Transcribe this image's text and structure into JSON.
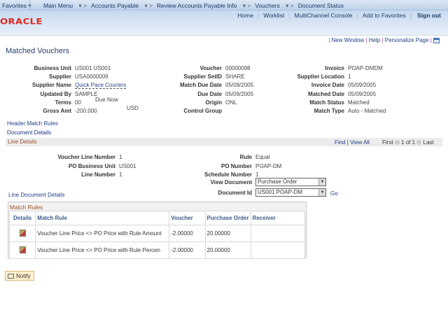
{
  "nav": {
    "favorites": "Favorites",
    "breadcrumb": [
      "Main Menu",
      "Accounts Payable",
      "Review Accounts Payable Info",
      "Vouchers",
      "Document Status"
    ],
    "links": [
      "Home",
      "Worklist",
      "MultiChannel Console",
      "Add to Favorites"
    ],
    "signout": "Sign out",
    "logo": "ORACLE"
  },
  "pagelinks": {
    "new_window": "New Window",
    "help": "Help",
    "personalize": "Personalize Page"
  },
  "title": "Matched Vouchers",
  "header": {
    "col1": [
      [
        "Business Unit",
        "US001   US001"
      ],
      [
        "Supplier",
        "USA0000009"
      ],
      [
        "Supplier Name",
        "Quick Pace Couriers"
      ],
      [
        "Updated By",
        "SAMPLE"
      ],
      [
        "Terms",
        "00"
      ],
      [
        "Gross Amt",
        "-200.000"
      ]
    ],
    "terms_desc": "Due Now",
    "currency": "USD",
    "col2": [
      [
        "Voucher",
        "00000098"
      ],
      [
        "Supplier SetID",
        "SHARE"
      ],
      [
        "Match Due Date",
        "05/09/2005"
      ],
      [
        "Due Date",
        "05/09/2005"
      ],
      [
        "Origin",
        "ONL"
      ],
      [
        "Control Group",
        ""
      ]
    ],
    "col3": [
      [
        "Invoice",
        "POAP-DMDM"
      ],
      [
        "Supplier Location",
        "1"
      ],
      [
        "Invoice Date",
        "05/09/2005"
      ],
      [
        "Matched Date",
        "05/09/2005"
      ],
      [
        "Match Status",
        "Matched"
      ],
      [
        "Match Type",
        "Auto - Matched"
      ]
    ]
  },
  "header_match_rules": "Header Match Rules",
  "document_details": "Document Details",
  "line_details": {
    "title": "Line Details",
    "find": "Find",
    "view_all": "View All",
    "first": "First",
    "count": "1 of 1",
    "last": "Last",
    "left": [
      [
        "Voucher Line Number",
        "1"
      ],
      [
        "PO Business Unit",
        "US001"
      ],
      [
        "Line Number",
        "1"
      ]
    ],
    "right": [
      [
        "Rule",
        "Equal"
      ],
      [
        "PO Number",
        "POAP-DM"
      ],
      [
        "Schedule Number",
        "1"
      ]
    ],
    "view_document_label": "View Document",
    "view_document": "Purchase Order",
    "document_id_label": "Document Id",
    "document_id": "US001 POAP-DM",
    "go": "Go",
    "line_document_details": "Line Document Details"
  },
  "match_rules": {
    "title": "Match Rules",
    "columns": [
      "Details",
      "Match Rule",
      "Voucher",
      "Purchase Order",
      "Receiver"
    ],
    "rows": [
      {
        "rule": "Voucher Line Price <> PO Price with Rule Amount",
        "voucher": "-2.00000",
        "po": "20.00000",
        "receiver": ""
      },
      {
        "rule": "Voucher Line Price <> PO Price with Rule Percen",
        "voucher": "-2.00000",
        "po": "20.00000",
        "receiver": ""
      }
    ]
  },
  "notify": "Notify",
  "colors": {
    "oracle_red": "#e2231a",
    "link": "#1e3c88",
    "section_title": "#a0522d"
  }
}
